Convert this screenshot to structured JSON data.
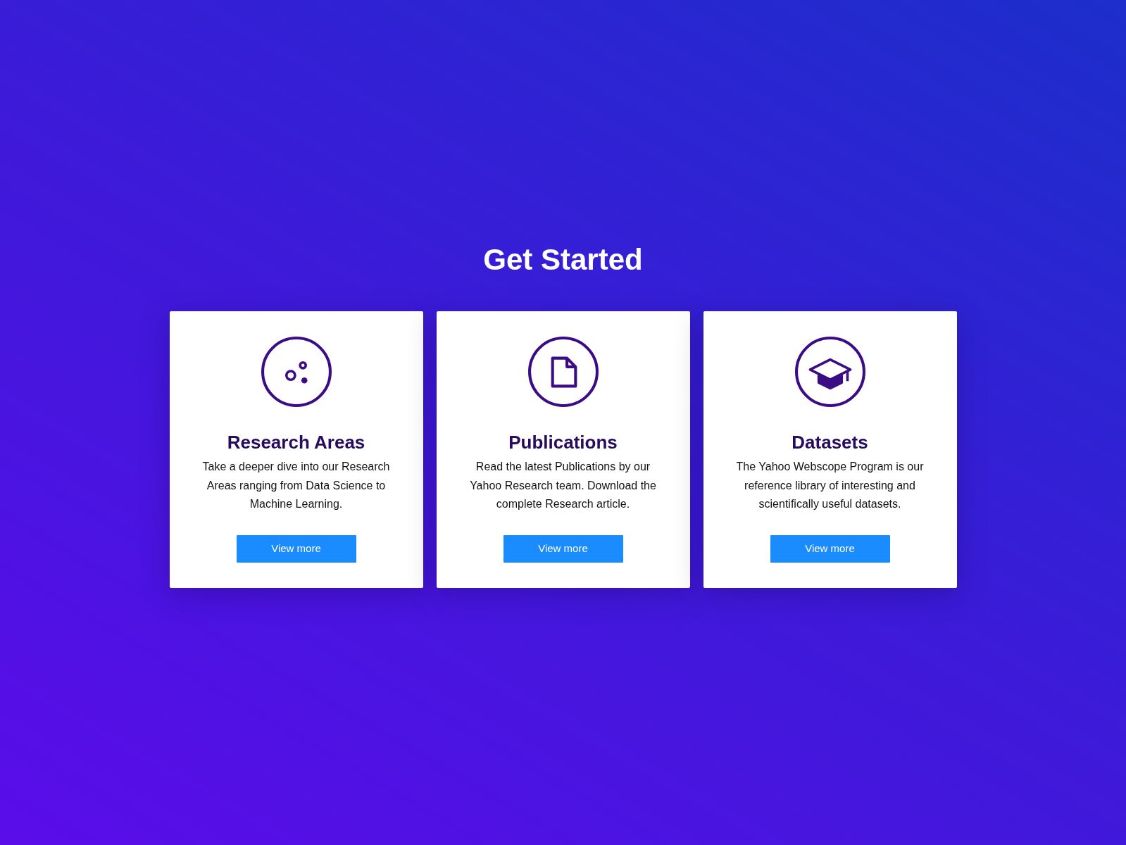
{
  "heading": "Get Started",
  "cards": [
    {
      "kind": "bubbles",
      "title": "Research Areas",
      "description": "Take a deeper dive into our Research Areas ranging from Data Science to Machine Learning.",
      "button": "View more"
    },
    {
      "kind": "document",
      "title": "Publications",
      "description": "Read the latest Publications by our Yahoo Research team. Download the complete Research article.",
      "button": "View more"
    },
    {
      "kind": "cap",
      "title": "Datasets",
      "description": "The Yahoo Webscope Program is our reference library of interesting and scientifically useful datasets.",
      "button": "View more"
    }
  ]
}
